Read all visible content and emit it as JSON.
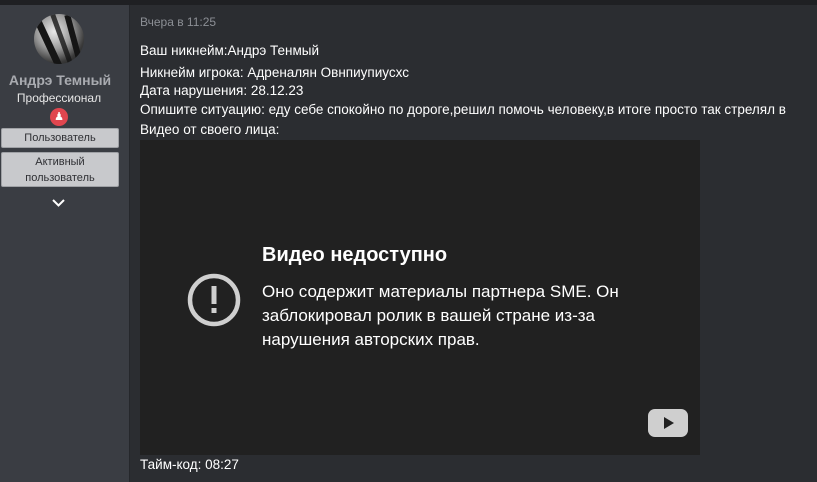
{
  "user": {
    "name": "Андрэ Темный",
    "rank": "Профессионал",
    "roles": [
      "Пользователь",
      "Активный пользователь"
    ]
  },
  "post": {
    "timestamp": "Вчера в 11:25",
    "lines": [
      "Ваш никнейм:Андрэ Тенмый",
      "Никнейм игрока: Адреналян Овнпиупиусхс",
      "Дата нарушения: 28.12.23",
      "Опишите ситуацию: еду себе спокойно по дороге,решил помочь человеку,в итоге просто так стрелял в",
      "Видео от своего лица:"
    ],
    "video": {
      "title": "Видео недоступно",
      "message": "Оно содержит материалы партнера SME. Он заблокировал ролик в вашей стране из-за нарушения авторских прав."
    },
    "timecode": "Тайм-код: 08:27"
  },
  "colors": {
    "background": "#2b2d31",
    "sidebar": "#3a3d43",
    "badge": "#e0464f",
    "role_bg": "#c8c9cc",
    "video_bg": "#212121"
  },
  "icons": [
    "avatar",
    "user-badge-icon",
    "chevron-down-icon",
    "error-icon",
    "youtube-icon"
  ]
}
